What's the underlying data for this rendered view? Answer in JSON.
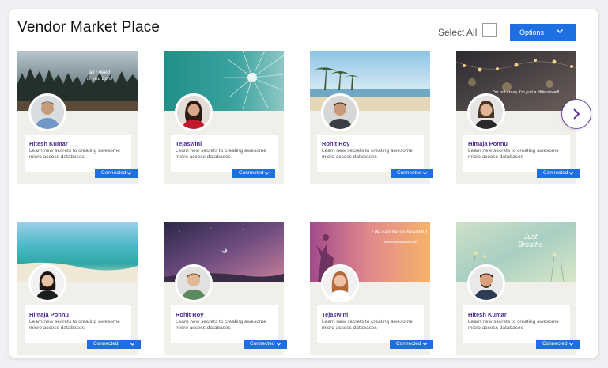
{
  "page": {
    "title": "Vendor Market Place",
    "select_all_label": "Select All",
    "options_label": "Options"
  },
  "colors": {
    "accent": "#1e6fe0",
    "name_text": "#4a2a8a",
    "card_bg": "#f1efea"
  },
  "cards": [
    {
      "name": "Hitesh Kumar",
      "description": "Learn new secrets to creating awesome micro access databases",
      "status": "Connected",
      "cover_text": "all i need is you Lord"
    },
    {
      "name": "Tejaswini",
      "description": "Learn new secrets to creating awesome micro access databases",
      "status": "Connected"
    },
    {
      "name": "Rohit Roy",
      "description": "Learn new secrets to creating awesome micro access databases",
      "status": "Connected"
    },
    {
      "name": "Himaja Ponnu",
      "description": "Learn new secrets to creating awesome micro access databases",
      "status": "Connected",
      "cover_text": "I'm not crazy, I'm just a little unwell"
    },
    {
      "name": "Himaja Ponnu",
      "description": "Learn new secrets to creating awesome micro access databases",
      "status": "Connected"
    },
    {
      "name": "Rohit Roy",
      "description": "Learn new secrets to creating awesome micro access databases",
      "status": "Connected"
    },
    {
      "name": "Tejaswini",
      "description": "Learn new secrets to creating awesome micro access databases",
      "status": "Connected",
      "cover_text": "Life can be so beautiful",
      "cover_subtext": "www.musicfestival.com"
    },
    {
      "name": "Hitesh Kumar",
      "description": "Learn new secrets to creating awesome micro access databases",
      "status": "Connected",
      "cover_text": "Just Breathe"
    }
  ],
  "icons": {
    "options": "chevron-down-icon",
    "next": "chevron-right-icon",
    "status": "chevron-down-icon"
  }
}
